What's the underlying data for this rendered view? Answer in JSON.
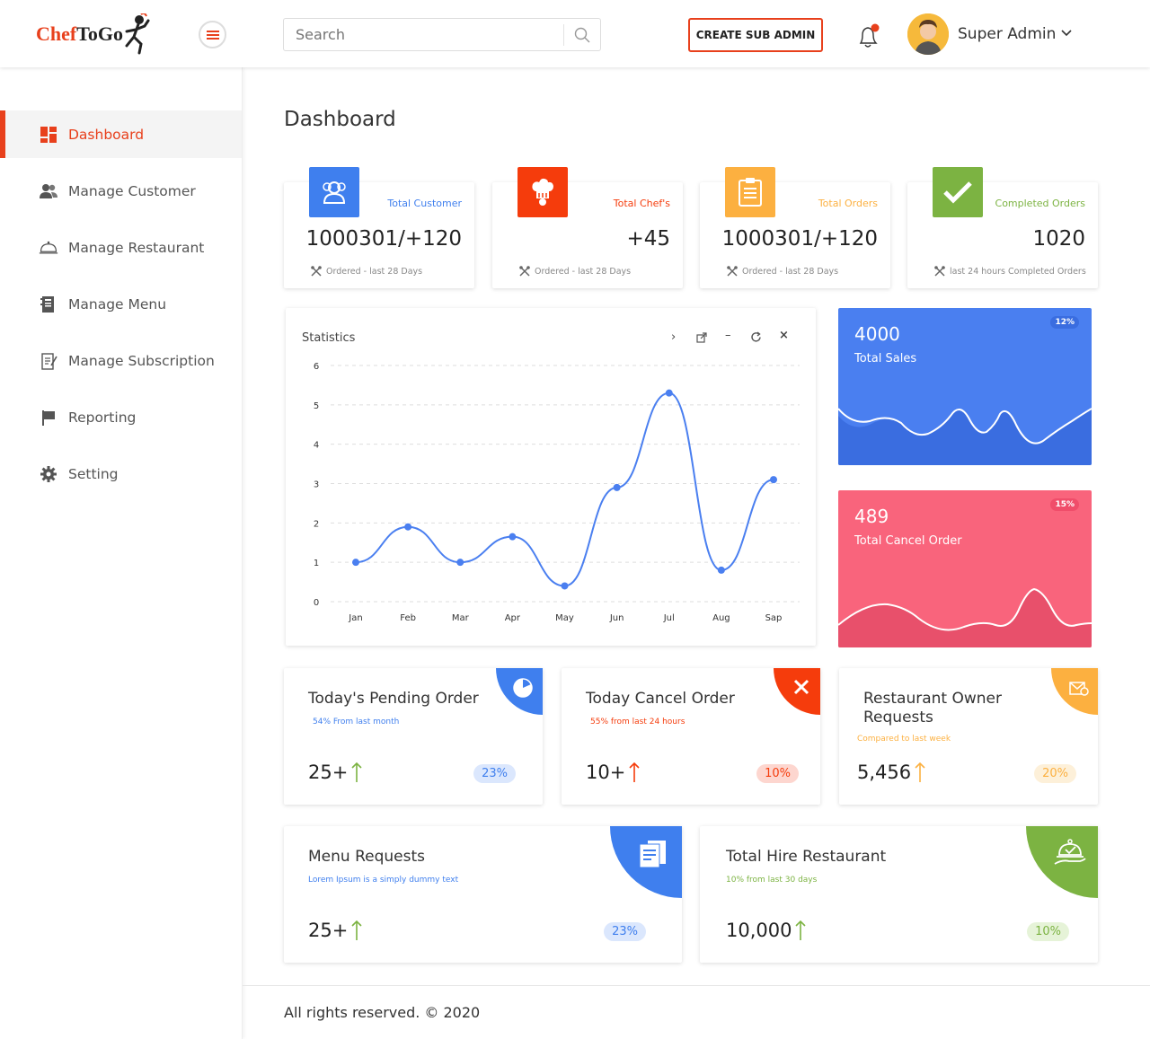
{
  "header": {
    "logo_text_1": "Chef",
    "logo_text_2": "ToGo",
    "search_placeholder": "Search",
    "create_button": "CREATE SUB ADMIN",
    "notification_count": "1",
    "user_name": "Super Admin"
  },
  "sidebar": {
    "items": [
      {
        "label": "Dashboard",
        "icon": "dashboard-icon",
        "active": true
      },
      {
        "label": "Manage Customer",
        "icon": "users-icon"
      },
      {
        "label": "Manage Restaurant",
        "icon": "cloche-icon"
      },
      {
        "label": "Manage Menu",
        "icon": "menu-book-icon"
      },
      {
        "label": "Manage Subscription",
        "icon": "subscription-icon"
      },
      {
        "label": "Reporting",
        "icon": "flag-icon"
      },
      {
        "label": "Setting",
        "icon": "gear-icon"
      }
    ]
  },
  "page_title": "Dashboard",
  "stats": [
    {
      "label": "Total Customer",
      "value": "1000301/+120",
      "note": "Ordered - last 28 Days",
      "color": "#3f7fee",
      "icon": "users-icon"
    },
    {
      "label": "Total Chef's",
      "value": "+45",
      "note": "Ordered - last 28 Days",
      "color": "#f53c0c",
      "icon": "chef-hat-icon"
    },
    {
      "label": "Total Orders",
      "value": "1000301/+120",
      "note": "Ordered - last 28 Days",
      "color": "#fcb040",
      "icon": "clipboard-icon"
    },
    {
      "label": "Completed Orders",
      "value": "1020",
      "note": "last 24 hours Completed Orders",
      "color": "#7cb342",
      "icon": "check-icon"
    }
  ],
  "statistics": {
    "title": "Statistics"
  },
  "chart_data": {
    "type": "line",
    "title": "Statistics",
    "categories": [
      "Jan",
      "Feb",
      "Mar",
      "Apr",
      "May",
      "Jun",
      "Jul",
      "Aug",
      "Sap"
    ],
    "values": [
      1,
      1.9,
      1,
      1.65,
      0.4,
      2.9,
      5.3,
      0.8,
      3.1
    ],
    "ylim": [
      0,
      6
    ],
    "yticks": [
      0,
      1,
      2,
      3,
      4,
      5,
      6
    ],
    "grid": true,
    "color": "#4a7ff0"
  },
  "kpis": [
    {
      "value": "4000",
      "label": "Total Sales",
      "badge": "12%",
      "color": "#4a7ff0"
    },
    {
      "value": "489",
      "label": "Total Cancel Order",
      "badge": "15%",
      "color": "#f9647c"
    }
  ],
  "minis": [
    {
      "title": "Today's Pending Order",
      "sub": "54% From last month",
      "value": "25+",
      "percent": "23%",
      "accent": "#3f7fee",
      "sub_color": "#3f7fee",
      "icon": "pie-chart-icon"
    },
    {
      "title": "Today Cancel Order",
      "sub": "55% from last 24 hours",
      "value": "10+",
      "percent": "10%",
      "accent": "#f53c0c",
      "sub_color": "#f53c0c",
      "icon": "close-icon"
    },
    {
      "title": "Restaurant Owner Requests",
      "sub": "Compared to last week",
      "value": "5,456",
      "percent": "20%",
      "accent": "#fcb040",
      "sub_color": "#fcb040",
      "icon": "mail-check-icon"
    },
    {
      "title": "Menu Requests",
      "sub": "Lorem Ipsum is a simply dummy text",
      "value": "25+",
      "percent": "23%",
      "accent": "#3f7fee",
      "sub_color": "#3f7fee",
      "icon": "menu-doc-icon"
    },
    {
      "title": "Total Hire Restaurant",
      "sub": "10% from last 30 days",
      "value": "10,000",
      "percent": "10%",
      "accent": "#7cb342",
      "sub_color": "#7cb342",
      "icon": "cloche-check-icon"
    }
  ],
  "footer": "All rights reserved. © 2020"
}
